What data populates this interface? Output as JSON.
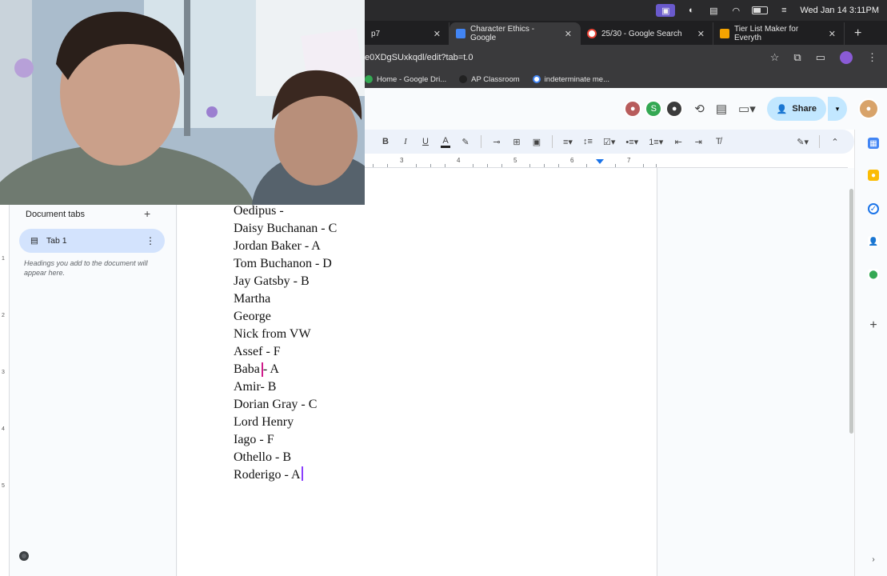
{
  "menubar": {
    "datetime": "Wed Jan 14  3:11PM"
  },
  "browser": {
    "tabs": [
      {
        "title": "p7",
        "favicon_color": "#888888"
      },
      {
        "title": "Character Ethics - Google",
        "favicon_color": "#4285f4"
      },
      {
        "title": "25/30 - Google Search",
        "favicon_color": "#ea4335"
      },
      {
        "title": "Tier List Maker for Everyth",
        "favicon_color": "#f4a300"
      }
    ],
    "new_tab_label": "+",
    "url": "e0XDgSUxkqdl/edit?tab=t.0",
    "bookmarks": [
      {
        "label": "Home - Google Dri...",
        "color": "#34a853"
      },
      {
        "label": "AP Classroom",
        "color": "#222222"
      },
      {
        "label": "indeterminate me...",
        "color": "#4285f4"
      }
    ]
  },
  "docs": {
    "share_label": "Share",
    "collaborator_initial": "S",
    "outline": {
      "title": "Document tabs",
      "add_label": "+",
      "tab_label": "Tab 1",
      "hint": "Headings you add to the document will appear here."
    },
    "ruler_numbers": [
      "3",
      "4",
      "5",
      "6",
      "7"
    ],
    "vertical_ruler_numbers": [
      "1",
      "2",
      "3",
      "4",
      "5"
    ],
    "lines": [
      "Oedipus -",
      "Daisy Buchanan - C",
      "Jordan Baker - A",
      "Tom Buchanon - D",
      "Jay Gatsby - B",
      "Martha",
      "George",
      "Nick from VW",
      "Assef  - F",
      "Baba - A",
      "Amir- B",
      "Dorian Gray - C",
      "Lord Henry",
      "Iago - F",
      "Othello - B",
      "Roderigo - A"
    ]
  },
  "colors": {
    "accent_blue": "#1a73e8",
    "share_bg": "#c2e7ff",
    "cursor_magenta": "#d01c8b",
    "cursor_purple": "#8a3ffc"
  }
}
